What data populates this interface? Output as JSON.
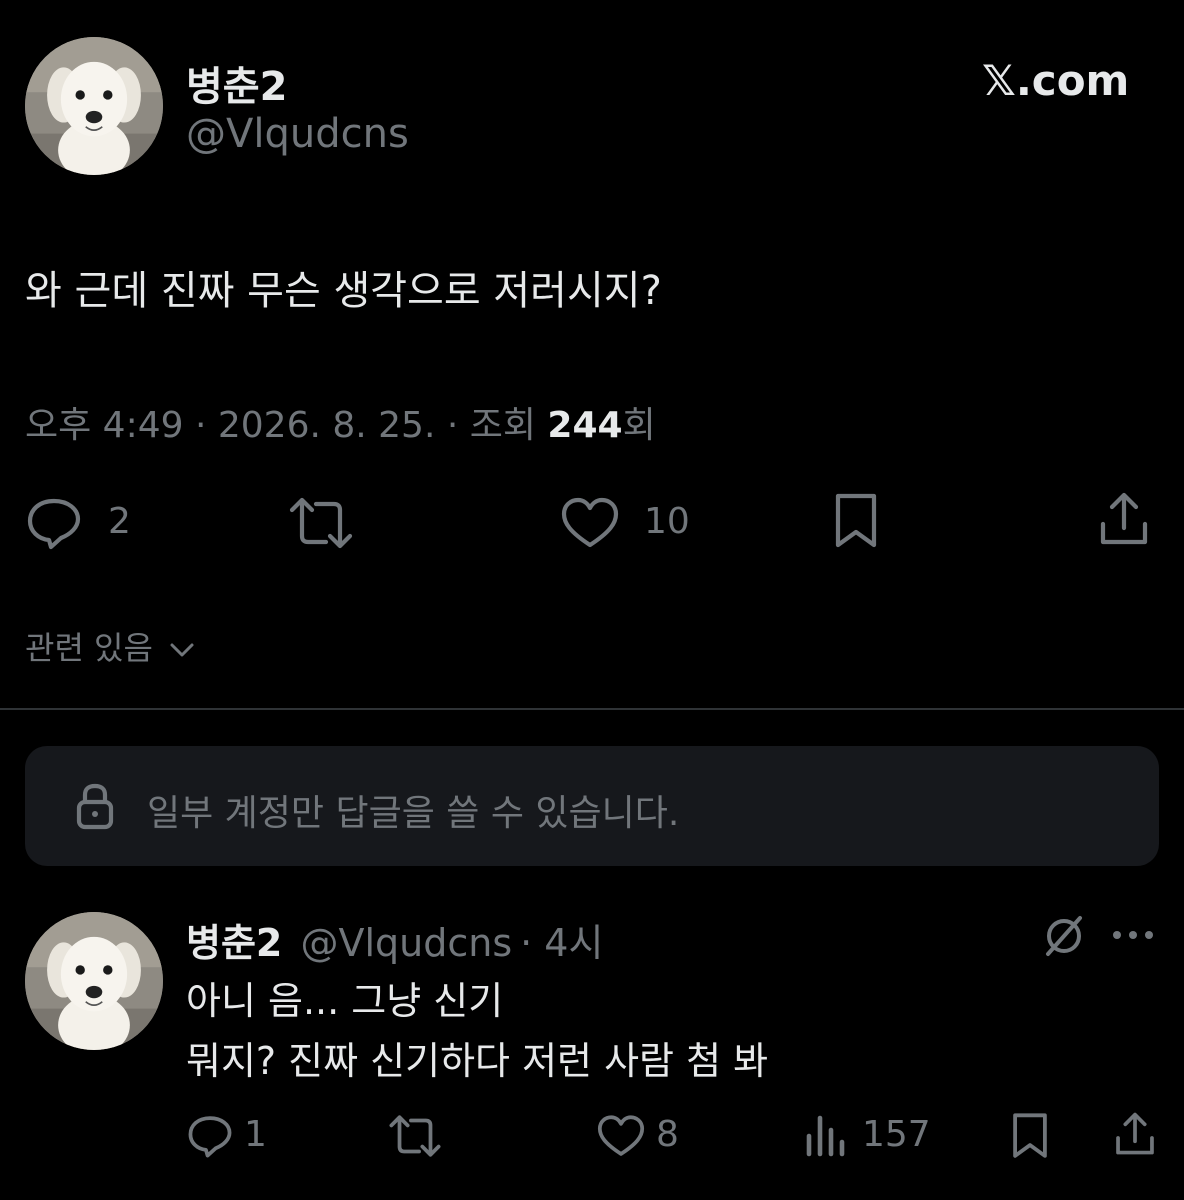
{
  "post": {
    "display_name": "병춘2",
    "handle": "@Vlqudcns",
    "brand": "𝕏.com",
    "text": "와 근데 진짜 무슨 생각으로 저러시지?",
    "meta_prefix": "오후 4:49 · 2026. 8. 25. · 조회 ",
    "views": "244",
    "views_suffix": "회",
    "actions": {
      "reply_count": "2",
      "like_count": "10"
    },
    "relevance_label": "관련 있음"
  },
  "reply_notice": {
    "text": "일부 계정만 답글을 쓸 수 있습니다.",
    "icon": "lock-icon"
  },
  "reply": {
    "display_name": "병춘2",
    "handle": "@Vlqudcns",
    "time": "· 4시",
    "line1": "아니 음... 그냥 신기",
    "line2": "뭐지? 진짜 신기하다 저런 사람 첨 봐",
    "actions": {
      "reply_count": "1",
      "like_count": "8",
      "view_count": "157"
    }
  },
  "colors": {
    "background": "#000000",
    "text": "#e7e9ea",
    "muted": "#71767b",
    "divider": "#2f3336",
    "notice_bg": "#16181c"
  }
}
